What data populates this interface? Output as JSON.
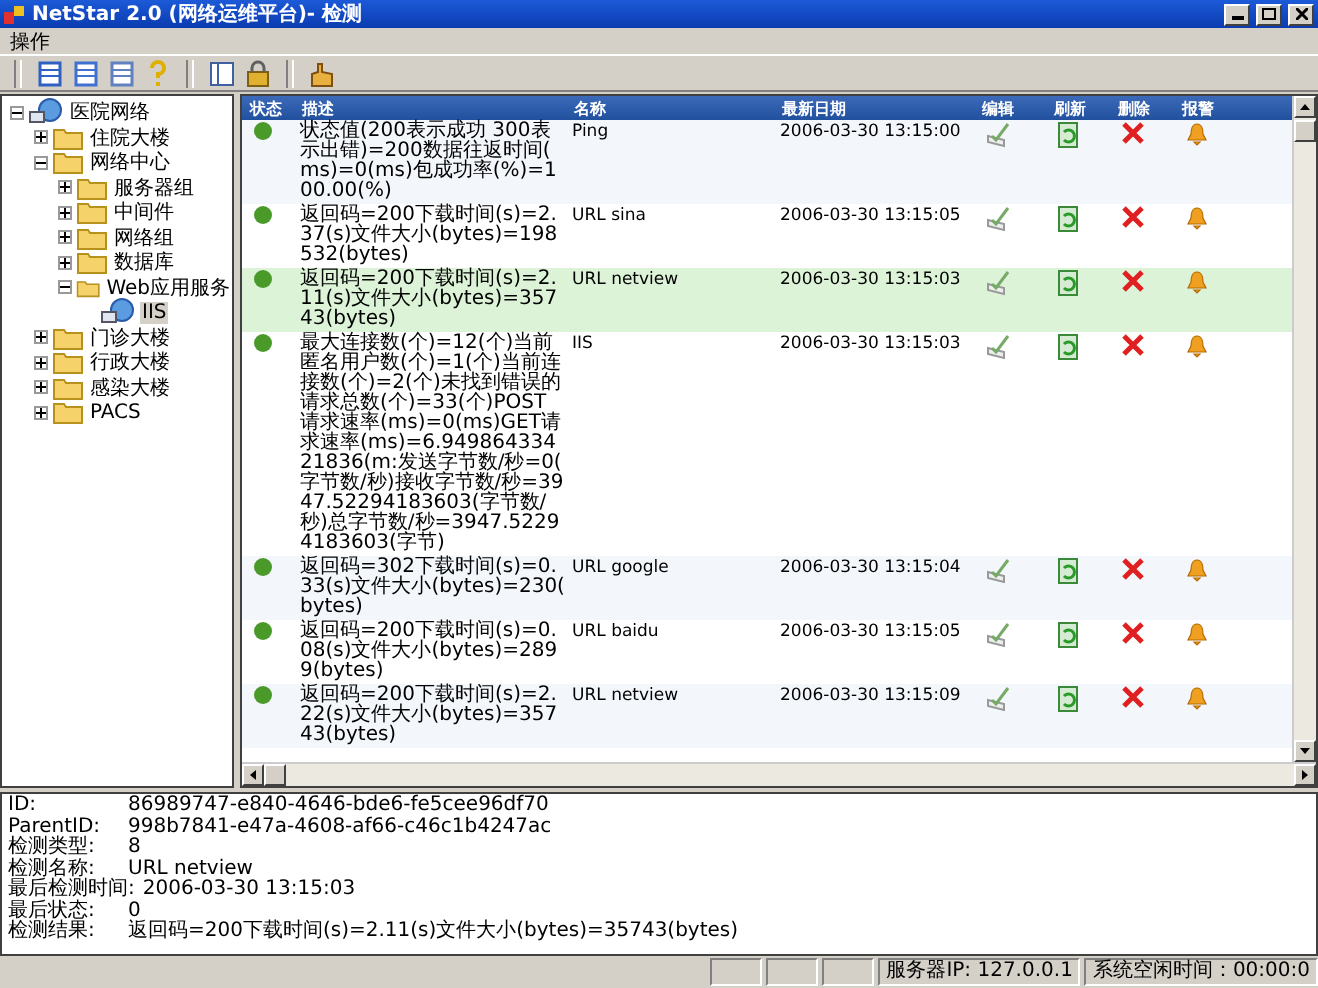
{
  "window": {
    "title": "NetStar 2.0 (网络运维平台)- 检测"
  },
  "menu": [
    "操作"
  ],
  "tree": [
    {
      "label": "医院网络",
      "kind": "network",
      "expanded": true,
      "selected": false,
      "children": [
        {
          "label": "住院大楼",
          "kind": "folder",
          "expanded": false,
          "selected": false
        },
        {
          "label": "网络中心",
          "kind": "folder",
          "expanded": true,
          "selected": false,
          "children": [
            {
              "label": "服务器组",
              "kind": "folder",
              "expanded": false,
              "selected": false
            },
            {
              "label": "中间件",
              "kind": "folder",
              "expanded": false,
              "selected": false
            },
            {
              "label": "网络组",
              "kind": "folder",
              "expanded": false,
              "selected": false
            },
            {
              "label": "数据库",
              "kind": "folder",
              "expanded": false,
              "selected": false
            },
            {
              "label": "Web应用服务",
              "kind": "folder",
              "expanded": true,
              "selected": false,
              "children": [
                {
                  "label": "IIS",
                  "kind": "network",
                  "selected": true
                }
              ]
            }
          ]
        },
        {
          "label": "门诊大楼",
          "kind": "folder",
          "expanded": false,
          "selected": false
        },
        {
          "label": "行政大楼",
          "kind": "folder",
          "expanded": false,
          "selected": false
        },
        {
          "label": "感染大楼",
          "kind": "folder",
          "expanded": false,
          "selected": false
        },
        {
          "label": "PACS",
          "kind": "folder",
          "expanded": false,
          "selected": false
        }
      ]
    }
  ],
  "table": {
    "columns": [
      "状态",
      "描述",
      "名称",
      "最新日期",
      "编辑",
      "刷新",
      "删除",
      "报警"
    ],
    "rows": [
      {
        "color": "#4a9a2a",
        "selected": false,
        "description": "状态值(200表示成功 300表示出错)=200数据往返时间(ms)=0(ms)包成功率(%)=100.00(%)",
        "name": "Ping",
        "date": "2006-03-30 13:15:00"
      },
      {
        "color": "#4a9a2a",
        "selected": false,
        "description": "返回码=200下载时间(s)=2.37(s)文件大小(bytes)=198532(bytes)",
        "name": "URL sina",
        "date": "2006-03-30 13:15:05"
      },
      {
        "color": "#4a9a2a",
        "selected": true,
        "description": "返回码=200下载时间(s)=2.11(s)文件大小(bytes)=35743(bytes)",
        "name": "URL netview",
        "date": "2006-03-30 13:15:03"
      },
      {
        "color": "#4a9a2a",
        "selected": false,
        "description": "最大连接数(个)=12(个)当前匿名用户数(个)=1(个)当前连接数(个)=2(个)未找到错误的请求总数(个)=33(个)POST请求速率(ms)=0(ms)GET请求速率(ms)=6.94986433421836(m:发送字节数/秒=0(字节数/秒)接收字节数/秒=3947.52294183603(字节数/秒)总字节数/秒=3947.52294183603(字节)",
        "name": "IIS",
        "date": "2006-03-30 13:15:03"
      },
      {
        "color": "#4a9a2a",
        "selected": false,
        "description": "返回码=302下载时间(s)=0.33(s)文件大小(bytes)=230(bytes)",
        "name": "URL google",
        "date": "2006-03-30 13:15:04"
      },
      {
        "color": "#4a9a2a",
        "selected": false,
        "description": "返回码=200下载时间(s)=0.08(s)文件大小(bytes)=2899(bytes)",
        "name": "URL baidu",
        "date": "2006-03-30 13:15:05"
      },
      {
        "color": "#4a9a2a",
        "selected": false,
        "description": "返回码=200下载时间(s)=2.22(s)文件大小(bytes)=35743(bytes)",
        "name": "URL netview",
        "date": "2006-03-30 13:15:09"
      }
    ]
  },
  "details": [
    {
      "label": "ID:",
      "value": "86989747-e840-4646-bde6-fe5cee96df70"
    },
    {
      "label": "ParentID:",
      "value": "998b7841-e47a-4608-af66-c46c1b4247ac"
    },
    {
      "label": "检测类型:",
      "value": "8"
    },
    {
      "label": "检测名称:",
      "value": "URL netview"
    },
    {
      "label": "最后检测时间:",
      "value": "2006-03-30 13:15:03"
    },
    {
      "label": "最后状态:",
      "value": "0"
    },
    {
      "label": "检测结果:",
      "value": "返回码=200下载时间(s)=2.11(s)文件大小(bytes)=35743(bytes)"
    }
  ],
  "status_bar": [
    "服务器IP: 127.0.0.1",
    "系统空闲时间：00:00:0"
  ]
}
